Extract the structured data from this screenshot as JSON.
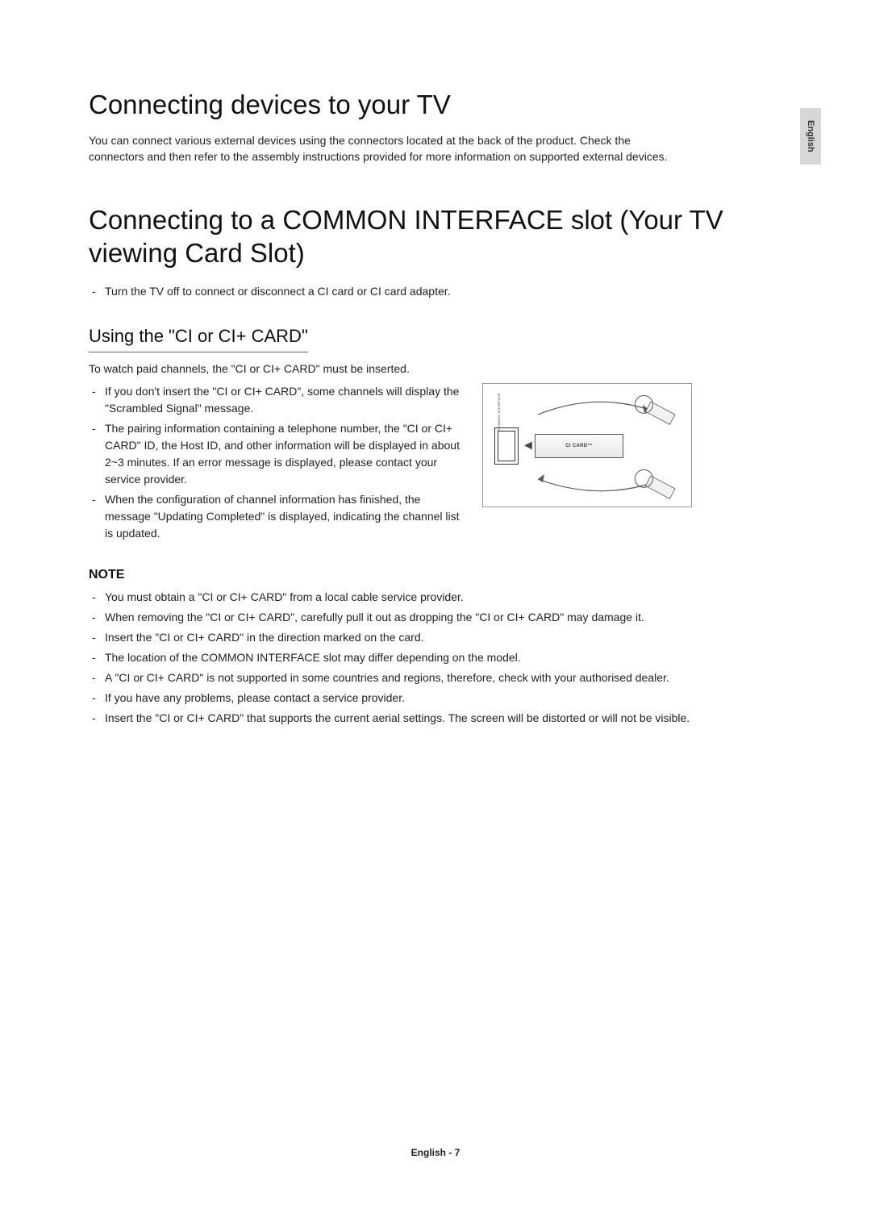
{
  "sideTab": "English",
  "heading1": "Connecting devices to your TV",
  "intro": "You can connect various external devices using the connectors located at the back of the product. Check the connectors and then refer to the assembly instructions provided for more information on supported external devices.",
  "heading2": "Connecting to a COMMON INTERFACE slot (Your TV viewing Card Slot)",
  "preList": [
    "Turn the TV off to connect or disconnect a CI card or CI card adapter."
  ],
  "subheading": "Using the \"CI or CI+ CARD\"",
  "subIntro": "To watch paid channels, the \"CI or CI+ CARD\" must be inserted.",
  "usingList": [
    "If you don't insert the \"CI or CI+ CARD\", some channels will display the \"Scrambled Signal\" message.",
    "The pairing information containing a telephone number, the \"CI or CI+ CARD\" ID, the Host ID, and other information will be displayed in about 2~3 minutes. If an error message is displayed, please contact your service provider.",
    "When the configuration of channel information has finished, the message \"Updating Completed\" is displayed, indicating the channel list is updated."
  ],
  "figure": {
    "slotLabel": "COMMON INTERFACE",
    "cardLabel": "CI CARD™"
  },
  "noteHeading": "NOTE",
  "noteList": [
    "You must obtain a \"CI or CI+ CARD\" from a local cable service provider.",
    "When removing the \"CI or CI+ CARD\", carefully pull it out as dropping the \"CI or CI+ CARD\" may damage it.",
    "Insert the \"CI or CI+ CARD\" in the direction marked on the card.",
    "The location of the COMMON INTERFACE slot may differ depending on the model.",
    "A \"CI or CI+ CARD\" is not supported in some countries and regions, therefore, check with your authorised dealer.",
    "If you have any problems, please contact a service provider.",
    "Insert the \"CI or CI+ CARD\" that supports the current aerial settings. The screen will be distorted or will not be visible."
  ],
  "footer": "English - 7"
}
